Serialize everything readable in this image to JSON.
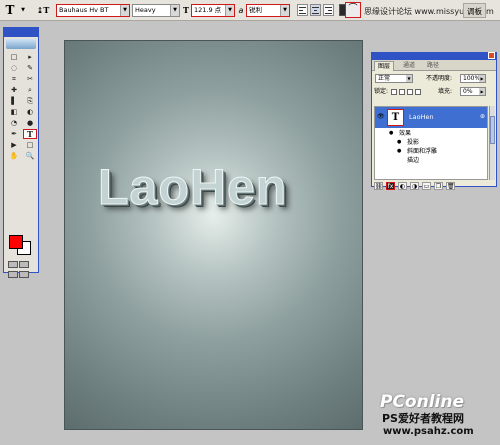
{
  "options_bar": {
    "tool_glyph": "T",
    "orientation_glyph": "↨T",
    "font_family": "Bauhaus Hv BT",
    "font_style": "Heavy",
    "size_glyph": "T",
    "font_size": "121.9 点",
    "aa_glyph": "a",
    "anti_alias": "锐利",
    "palettes_label": "调板",
    "colors": {
      "text_color": "#2a2a2a",
      "highlight": "#d01818"
    }
  },
  "brand_label": "思缘设计论坛 www.missyuan.com",
  "toolbox": {
    "tools": [
      "□",
      "▸",
      "◌",
      "✎",
      "⌗",
      "✂",
      "✚",
      "⌕",
      "▌",
      "⎘",
      "◧",
      "◐",
      "◔",
      "●",
      "✒",
      "T",
      "▶",
      "□",
      "✋",
      "🔍"
    ],
    "foreground": "#ff0000",
    "background": "#ffffff"
  },
  "canvas": {
    "text": "LaoHen"
  },
  "layers_panel": {
    "tabs": [
      "图层",
      "通道",
      "路径"
    ],
    "blend_mode": "正常",
    "opacity_label": "不透明度:",
    "opacity_value": "100%",
    "lock_label": "锁定:",
    "fill_label": "填充:",
    "fill_value": "0%",
    "layer": {
      "thumb": "T",
      "name": "LaoHen",
      "fx": "⊛"
    },
    "effects_label": "效果",
    "effects": [
      "投影",
      "斜面和浮雕",
      "描边"
    ],
    "bottom_icons": [
      "⛓",
      "fx",
      "◐",
      "◑",
      "▭",
      "❐",
      "🗑"
    ]
  },
  "watermark": {
    "brand": "PConline",
    "line1": "PS爱好者教程网",
    "line2": "www.psahz.com"
  }
}
